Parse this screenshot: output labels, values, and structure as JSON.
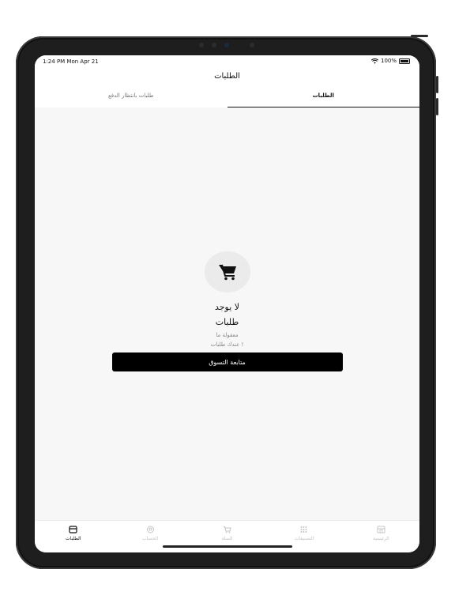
{
  "status_bar": {
    "time": "1:24 PM  Mon Apr 21",
    "battery": "100%"
  },
  "header": {
    "title": "الطلبات"
  },
  "tabs": [
    {
      "label": "الطلبات",
      "active": true
    },
    {
      "label": "طلبات بانتظار الدفع",
      "active": false
    }
  ],
  "empty_state": {
    "icon": "shopping-cart-icon",
    "title_line1": "لا يوجد",
    "title_line2": "طلبات",
    "subtitle_line1": "معقولة ما",
    "subtitle_line2": "عندك طلبات !",
    "button_label": "متابعة التسوق"
  },
  "tab_bar": {
    "items": [
      {
        "label": "الطلبات",
        "icon": "orders-icon",
        "active": true
      },
      {
        "label": "الحساب",
        "icon": "account-icon",
        "active": false
      },
      {
        "label": "السلة",
        "icon": "cart-icon",
        "active": false
      },
      {
        "label": "التصنيفات",
        "icon": "grid-icon",
        "active": false
      },
      {
        "label": "الرئيسية",
        "icon": "store-icon",
        "active": false
      }
    ]
  },
  "colors": {
    "accent": "#000000",
    "background": "#f7f7f7",
    "inactive": "#c4c4c4"
  }
}
